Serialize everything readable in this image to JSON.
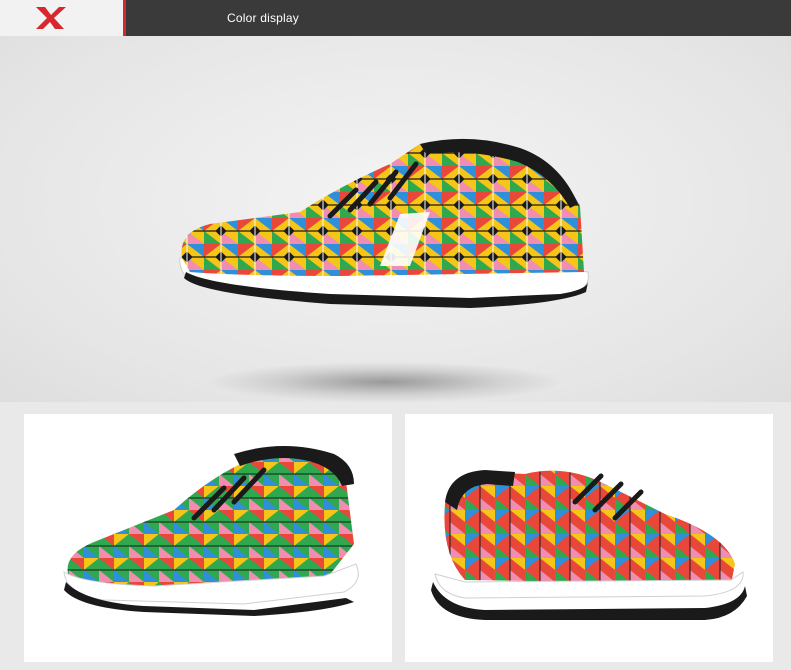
{
  "header": {
    "title": "Color display",
    "brand_color": "#d8282f",
    "bar_color": "#3a3a3a"
  },
  "images": {
    "hero": "colorful-geometric-pattern-sneaker-side-view",
    "left_panel": "colorful-sneaker-three-quarter-front-view",
    "right_panel": "colorful-sneaker-rear-three-quarter-view"
  },
  "palette": [
    "#e8473a",
    "#f5c518",
    "#2f8fd8",
    "#2fa84f",
    "#f08db0",
    "#1a1a1a",
    "#ffffff"
  ]
}
